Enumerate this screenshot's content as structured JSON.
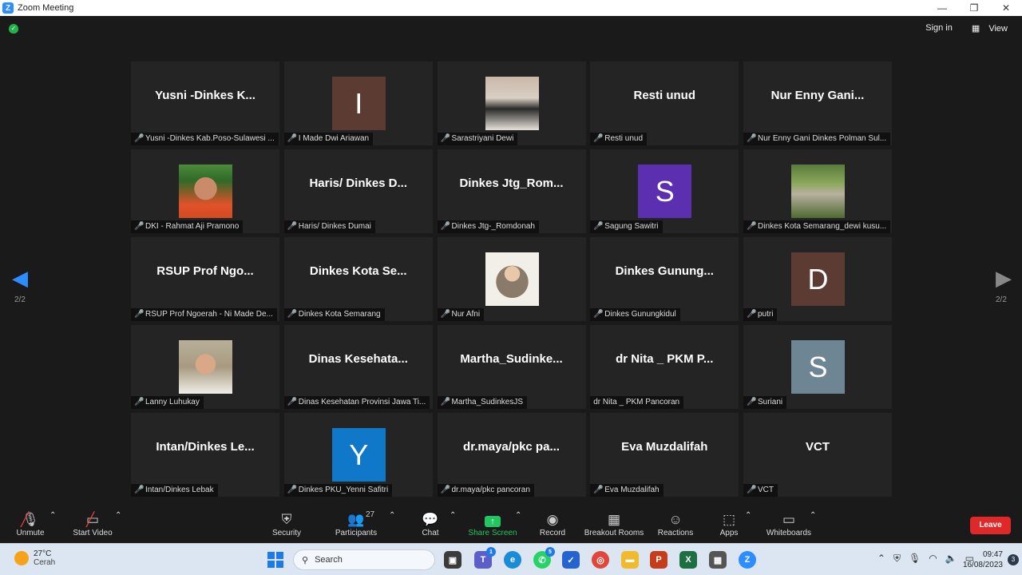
{
  "window": {
    "title": "Zoom Meeting"
  },
  "topbar": {
    "sign_in": "Sign in",
    "view": "View"
  },
  "pager": {
    "left": "2/2",
    "right": "2/2"
  },
  "participants": [
    {
      "big": "Yusni -Dinkes K...",
      "name": "Yusni -Dinkes Kab.Poso-Sulawesi ..."
    },
    {
      "avatar_letter": "I",
      "avatar_color": "#5c3c32",
      "name": "I Made Dwi Ariawan"
    },
    {
      "photo": "woman-mask-icon",
      "name": "Sarastriyani Dewi"
    },
    {
      "big": "Resti unud",
      "name": "Resti unud"
    },
    {
      "big": "Nur Enny Gani...",
      "name": "Nur Enny Gani Dinkes Polman Sul..."
    },
    {
      "photo": "man-cap-icon",
      "name": "DKI - Rahmat Aji Pramono"
    },
    {
      "big": "Haris/ Dinkes D...",
      "name": "Haris/ Dinkes Dumai"
    },
    {
      "big": "Dinkes Jtg_Rom...",
      "name": "Dinkes Jtg-_Romdonah"
    },
    {
      "avatar_letter": "S",
      "avatar_color": "#5b2fb0",
      "name": "Sagung Sawitri"
    },
    {
      "photo": "woman-garden-icon",
      "name": "Dinkes Kota Semarang_dewi kusu..."
    },
    {
      "big": "RSUP Prof Ngo...",
      "name": "RSUP Prof Ngoerah - Ni Made De..."
    },
    {
      "big": "Dinkes Kota Se...",
      "name": "Dinkes Kota Semarang"
    },
    {
      "photo": "woman-hijab-icon",
      "name": "Nur Afni"
    },
    {
      "big": "Dinkes Gunung...",
      "name": "Dinkes Gunungkidul"
    },
    {
      "avatar_letter": "D",
      "avatar_color": "#5c3c32",
      "name": "putri"
    },
    {
      "photo": "woman-smile-icon",
      "name": "Lanny Luhukay"
    },
    {
      "big": "Dinas Kesehata...",
      "name": "Dinas Kesehatan Provinsi Jawa Ti..."
    },
    {
      "big": "Martha_Sudinke...",
      "name": "Martha_SudinkesJS"
    },
    {
      "big": "dr Nita _ PKM P...",
      "name": "dr Nita _ PKM Pancoran",
      "no_mic": true
    },
    {
      "avatar_letter": "S",
      "avatar_color": "#6e8593",
      "name": "Suriani"
    },
    {
      "big": "Intan/Dinkes Le...",
      "name": "Intan/Dinkes Lebak"
    },
    {
      "avatar_letter": "Y",
      "avatar_color": "#0f78c8",
      "name": "Dinkes PKU_Yenni Safitri"
    },
    {
      "big": "dr.maya/pkc pa...",
      "name": "dr.maya/pkc pancoran"
    },
    {
      "big": "Eva Muzdalifah",
      "name": "Eva Muzdalifah"
    },
    {
      "big": "VCT",
      "name": "VCT"
    }
  ],
  "toolbar": {
    "unmute": "Unmute",
    "start_video": "Start Video",
    "security": "Security",
    "participants": "Participants",
    "participant_count": "27",
    "chat": "Chat",
    "share_screen": "Share Screen",
    "record": "Record",
    "breakout": "Breakout Rooms",
    "reactions": "Reactions",
    "apps": "Apps",
    "whiteboards": "Whiteboards",
    "leave": "Leave"
  },
  "taskbar": {
    "temperature": "27°C",
    "condition": "Cerah",
    "search_placeholder": "Search",
    "time": "09:47",
    "date": "16/08/2023",
    "notifications": "3",
    "badge_teams": "1",
    "badge_whatsapp": "5"
  },
  "colors": {
    "accent": "#2d8cff",
    "leave": "#e02828",
    "share": "#22c55e",
    "muted": "#e03e3e"
  }
}
